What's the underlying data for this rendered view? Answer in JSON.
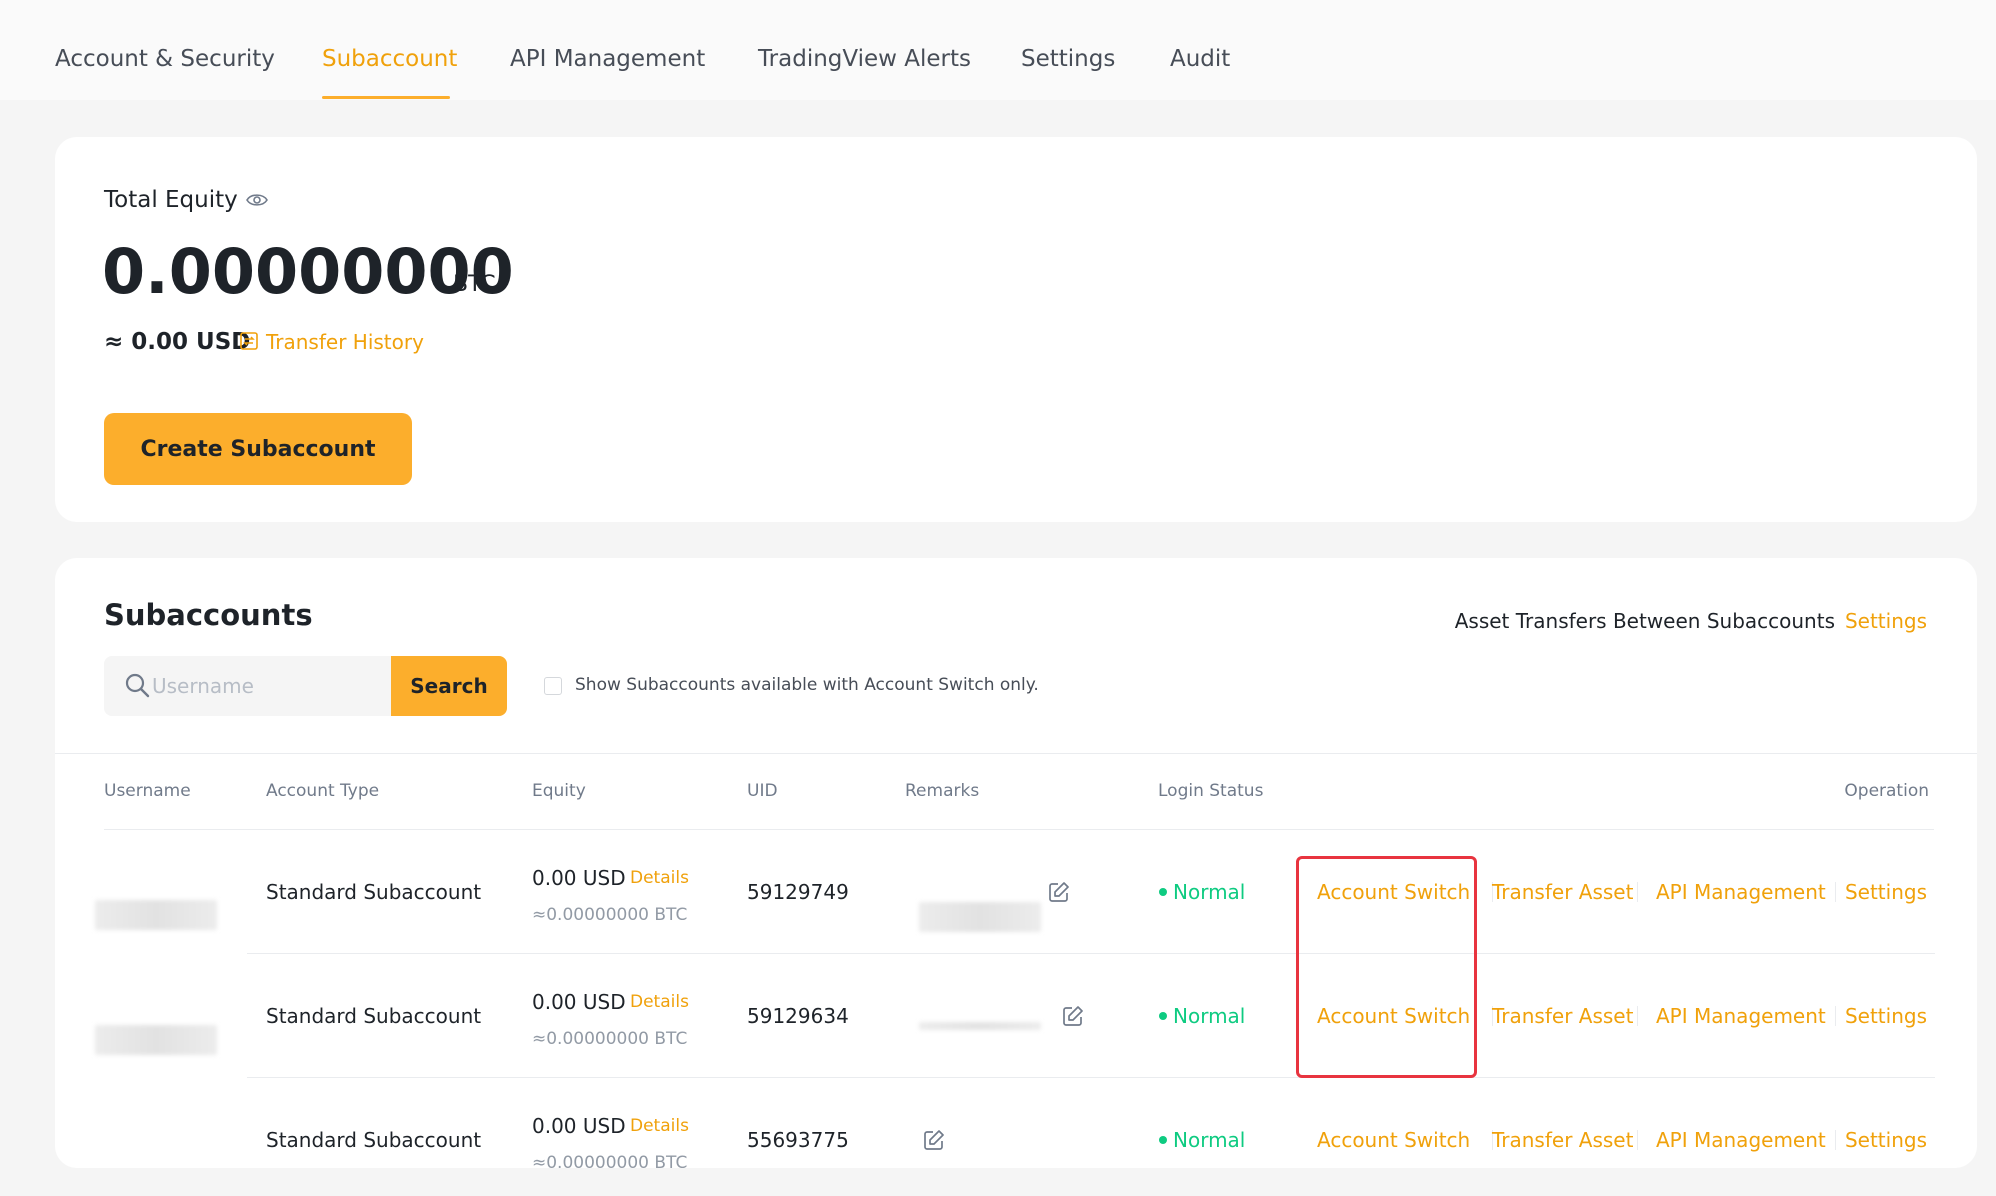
{
  "nav": {
    "tabs": [
      {
        "label": "Account & Security"
      },
      {
        "label": "Subaccount"
      },
      {
        "label": "API Management"
      },
      {
        "label": "TradingView Alerts"
      },
      {
        "label": "Settings"
      },
      {
        "label": "Audit"
      }
    ],
    "active_tab": "Subaccount"
  },
  "equity": {
    "label": "Total Equity",
    "value": "0.00000000",
    "unit": "BTC",
    "usd": "≈ 0.00 USD",
    "history_link": "Transfer History",
    "create_button": "Create Subaccount"
  },
  "subaccounts": {
    "title": "Subaccounts",
    "transfers_text": "Asset Transfers Between Subaccounts",
    "transfers_link": "Settings",
    "search": {
      "placeholder": "Username",
      "button": "Search"
    },
    "filter_label": "Show Subaccounts available with Account Switch only.",
    "columns": [
      "Username",
      "Account Type",
      "Equity",
      "UID",
      "Remarks",
      "Login Status",
      "Operation"
    ],
    "rows": [
      {
        "account_type": "Standard Subaccount",
        "equity_usd": "0.00 USD",
        "details": "Details",
        "equity_btc": "≈0.00000000 BTC",
        "uid": "59129749",
        "status": "Normal"
      },
      {
        "account_type": "Standard Subaccount",
        "equity_usd": "0.00 USD",
        "details": "Details",
        "equity_btc": "≈0.00000000 BTC",
        "uid": "59129634",
        "status": "Normal"
      },
      {
        "account_type": "Standard Subaccount",
        "equity_usd": "0.00 USD",
        "details": "Details",
        "equity_btc": "≈0.00000000 BTC",
        "uid": "55693775",
        "status": "Normal"
      }
    ],
    "operations": [
      "Account Switch",
      "Transfer Asset",
      "API Management",
      "Settings"
    ]
  },
  "colors": {
    "accent": "#fcae2c",
    "link": "#f0a10b",
    "status_normal": "#0ecb81",
    "highlight": "#e8343f"
  }
}
